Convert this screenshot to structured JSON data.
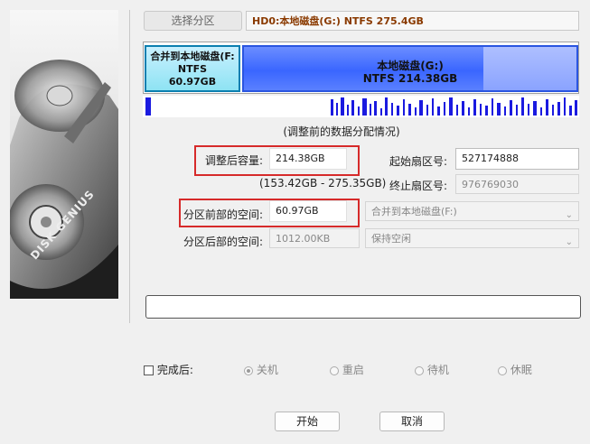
{
  "header": {
    "select_partition_label": "选择分区",
    "selected_partition": "HD0:本地磁盘(G:) NTFS 275.4GB"
  },
  "brand": {
    "logo_text": "DISK GENIUS"
  },
  "disk_map": {
    "partitions": [
      {
        "line1": "合并到本地磁盘(F:",
        "line2": "NTFS",
        "line3": "60.97GB",
        "color": "#8ee3f3"
      },
      {
        "line1": "本地磁盘(G:)",
        "line2": "NTFS 214.38GB",
        "color": "#3a66ff"
      }
    ]
  },
  "info": {
    "caption": "(调整前的数据分配情况)"
  },
  "form": {
    "resized_capacity": {
      "label": "调整后容量:",
      "value": "214.38GB"
    },
    "range_hint": "(153.42GB - 275.35GB)",
    "start_sector": {
      "label": "起始扇区号:",
      "value": "527174888"
    },
    "end_sector": {
      "label": "终止扇区号:",
      "value": "976769030"
    },
    "space_before": {
      "label": "分区前部的空间:",
      "value": "60.97GB",
      "action": "合并到本地磁盘(F:)"
    },
    "space_after": {
      "label": "分区后部的空间:",
      "value": "1012.00KB",
      "action": "保持空闲"
    }
  },
  "progress": {
    "value": 0
  },
  "completion": {
    "label": "完成后:",
    "options": [
      "关机",
      "重启",
      "待机",
      "休眠"
    ],
    "selected": "关机"
  },
  "buttons": {
    "start": "开始",
    "cancel": "取消"
  },
  "colors": {
    "highlight_border": "#d62a2a",
    "partition_blue": "#3a66ff",
    "partition_cyan": "#8ee3f3"
  }
}
